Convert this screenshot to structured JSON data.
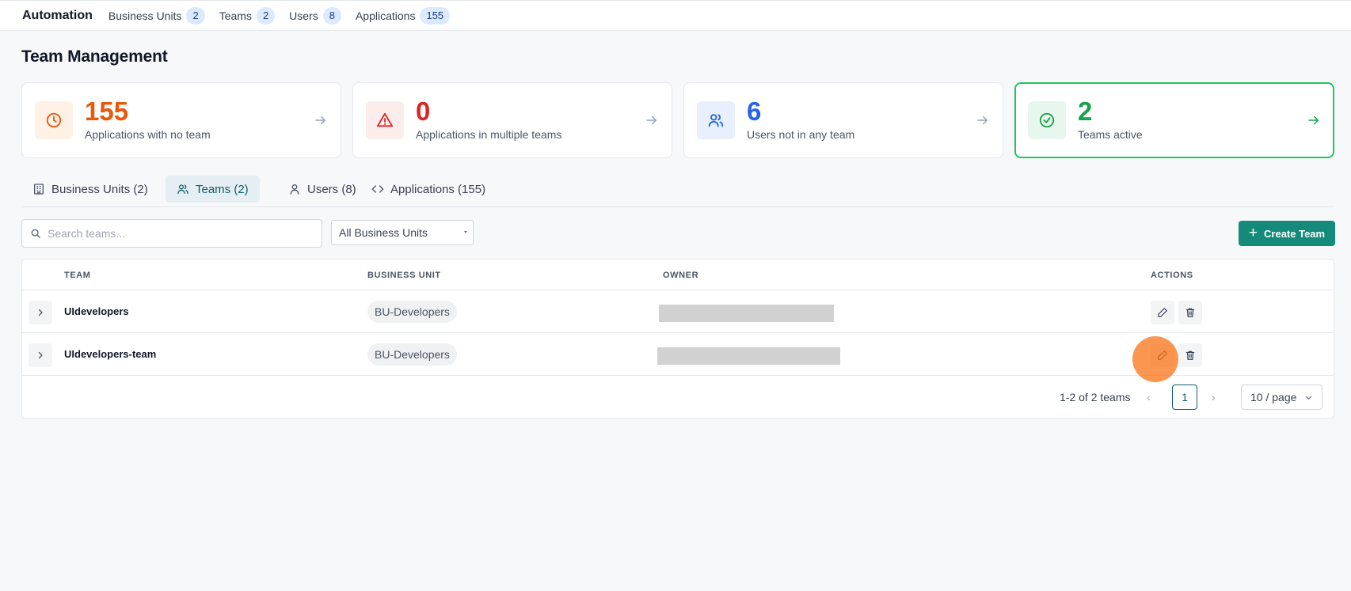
{
  "nav": {
    "brand": "Automation",
    "items": [
      {
        "label": "Business Units",
        "count": "2"
      },
      {
        "label": "Teams",
        "count": "2"
      },
      {
        "label": "Users",
        "count": "8"
      },
      {
        "label": "Applications",
        "count": "155"
      }
    ]
  },
  "page": {
    "title": "Team Management"
  },
  "stats": [
    {
      "value": "155",
      "label": "Applications with no team",
      "color": "#ea580c",
      "icon": "clock-icon"
    },
    {
      "value": "0",
      "label": "Applications in multiple teams",
      "color": "#dc2626",
      "icon": "warning-icon"
    },
    {
      "value": "6",
      "label": "Users not in any team",
      "color": "#2563eb",
      "icon": "users-icon"
    },
    {
      "value": "2",
      "label": "Teams active",
      "color": "#16a34a",
      "icon": "check-circle-icon"
    }
  ],
  "tabs": [
    {
      "label": "Business Units (2)",
      "icon": "building-icon"
    },
    {
      "label": "Teams (2)",
      "icon": "users-icon"
    },
    {
      "label": "Users (8)",
      "icon": "user-icon"
    },
    {
      "label": "Applications (155)",
      "icon": "code-icon"
    }
  ],
  "toolbar": {
    "search_placeholder": "Search teams...",
    "business_unit_filter": "All Business Units",
    "create_label": "Create Team"
  },
  "table": {
    "columns": [
      "TEAM",
      "BUSINESS UNIT",
      "OWNER",
      "ACTIONS"
    ],
    "rows": [
      {
        "team": "UIdevelopers",
        "business_unit": "BU-Developers"
      },
      {
        "team": "UIdevelopers-team",
        "business_unit": "BU-Developers"
      }
    ]
  },
  "pagination": {
    "summary": "1-2 of 2 teams",
    "current_page": "1",
    "page_size": "10 / page"
  }
}
